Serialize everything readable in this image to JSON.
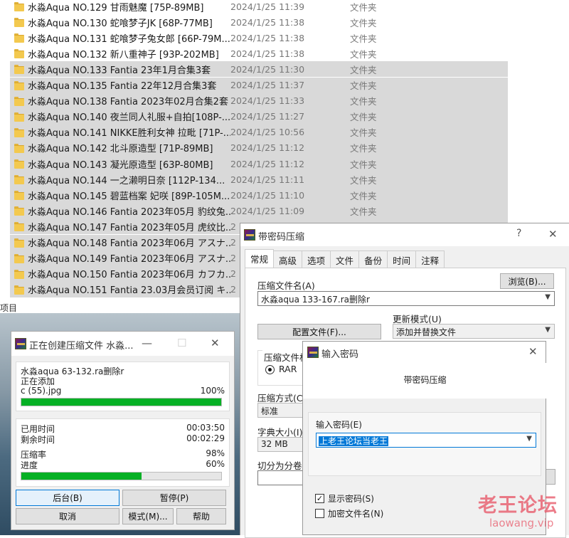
{
  "explorer": {
    "files": [
      {
        "name": "水淼Aqua NO.129 甘雨魅魔 [75P-89MB]",
        "date": "2024/1/25 11:39",
        "type": "文件夹",
        "selected": false
      },
      {
        "name": "水淼Aqua NO.130 蛇喰梦子JK [68P-77MB]",
        "date": "2024/1/25 11:38",
        "type": "文件夹",
        "selected": false
      },
      {
        "name": "水淼Aqua NO.131 蛇喰梦子兔女郎 [66P-79M...",
        "date": "2024/1/25 11:38",
        "type": "文件夹",
        "selected": false
      },
      {
        "name": "水淼Aqua NO.132 新八重神子 [93P-202MB]",
        "date": "2024/1/25 11:38",
        "type": "文件夹",
        "selected": false
      },
      {
        "name": "水淼Aqua NO.133 Fantia 23年1月合集3套",
        "date": "2024/1/25 11:30",
        "type": "文件夹",
        "selected": true
      },
      {
        "name": "水淼Aqua NO.135 Fantia 22年12月合集3套",
        "date": "2024/1/25 11:37",
        "type": "文件夹",
        "selected": true
      },
      {
        "name": "水淼Aqua NO.138 Fantia 2023年02月合集2套",
        "date": "2024/1/25 11:33",
        "type": "文件夹",
        "selected": true
      },
      {
        "name": "水淼Aqua NO.140 夜兰同人礼服+自拍[108P-...",
        "date": "2024/1/25 11:27",
        "type": "文件夹",
        "selected": true
      },
      {
        "name": "水淼Aqua NO.141 NIKKE胜利女神 拉毗 [71P-...",
        "date": "2024/1/25 10:56",
        "type": "文件夹",
        "selected": true
      },
      {
        "name": "水淼Aqua NO.142 北斗原造型 [71P-89MB]",
        "date": "2024/1/25 11:12",
        "type": "文件夹",
        "selected": true
      },
      {
        "name": "水淼Aqua NO.143 凝光原造型 [63P-80MB]",
        "date": "2024/1/25 11:12",
        "type": "文件夹",
        "selected": true
      },
      {
        "name": "水淼Aqua NO.144 一之濑明日奈 [112P-134...",
        "date": "2024/1/25 11:11",
        "type": "文件夹",
        "selected": true
      },
      {
        "name": "水淼Aqua NO.145 碧蓝档案 妃咲 [89P-105M...",
        "date": "2024/1/25 11:10",
        "type": "文件夹",
        "selected": true
      },
      {
        "name": "水淼Aqua NO.146 Fantia 2023年05月 豹纹兔...",
        "date": "2024/1/25 11:09",
        "type": "文件夹",
        "selected": true
      },
      {
        "name": "水淼Aqua NO.147 Fantia 2023年05月 虎纹比...",
        "date": "2",
        "type": "",
        "selected": true
      },
      {
        "name": "水淼Aqua NO.148 Fantia 2023年06月 アスナ...",
        "date": "2",
        "type": "",
        "selected": true
      },
      {
        "name": "水淼Aqua NO.149 Fantia 2023年06月 アスナ...",
        "date": "2",
        "type": "",
        "selected": true
      },
      {
        "name": "水淼Aqua NO.150 Fantia 2023年06月 カフカ...",
        "date": "2",
        "type": "",
        "selected": true
      },
      {
        "name": "水淼Aqua NO.151 Fantia 23.03月会员订阅 キ...",
        "date": "2",
        "type": "",
        "selected": true
      }
    ],
    "status": "项目"
  },
  "progress_window": {
    "title": "正在创建压缩文件 水淼...",
    "archive_name": "水淼aqua 63-132.ra删除r",
    "action": "正在添加",
    "current_file": "c (55).jpg",
    "file_percent": "100%",
    "file_progress": 1.0,
    "elapsed_label": "已用时间",
    "elapsed_value": "00:03:50",
    "remaining_label": "剩余时间",
    "remaining_value": "00:02:29",
    "ratio_label": "压缩率",
    "ratio_value": "98%",
    "progress_label": "进度",
    "progress_value": "60%",
    "overall_progress": 0.6,
    "buttons": {
      "background": "后台(B)",
      "pause": "暂停(P)",
      "cancel": "取消",
      "mode": "模式(M)...",
      "help": "帮助"
    }
  },
  "archive_dialog": {
    "title": "带密码压缩",
    "help_glyph": "?",
    "close_glyph": "✕",
    "tabs": [
      "常规",
      "高级",
      "选项",
      "文件",
      "备份",
      "时间",
      "注释"
    ],
    "archive_name_label": "压缩文件名(A)",
    "browse_button": "浏览(B)...",
    "archive_name_value": "水淼aqua 133-167.ra删除r",
    "profiles_button": "配置文件(F)...",
    "update_mode_label": "更新模式(U)",
    "update_mode_value": "添加并替换文件",
    "format_label": "压缩文件格式",
    "format_rar": "RAR",
    "method_label": "压缩方式(C)",
    "method_value": "标准",
    "dict_label": "字典大小(I)",
    "dict_value": "32 MB",
    "split_label": "切分为分卷(V"
  },
  "password_dialog": {
    "title": "输入密码",
    "close_glyph": "✕",
    "subtitle": "带密码压缩",
    "password_label": "输入密码(E)",
    "password_value": "上老王论坛当老王",
    "show_password_label": "显示密码(S)",
    "show_password_checked": true,
    "encrypt_names_label": "加密文件名(N)",
    "encrypt_names_checked": false
  },
  "watermark": {
    "text": "老王论坛",
    "url": "laowang.vip"
  },
  "colors": {
    "selection_gray": "#d9d9d9",
    "progress_green": "#06b025",
    "accent_blue": "#0078d7",
    "folder_yellow": "#f3c94f",
    "watermark_red": "#e85c6c"
  }
}
